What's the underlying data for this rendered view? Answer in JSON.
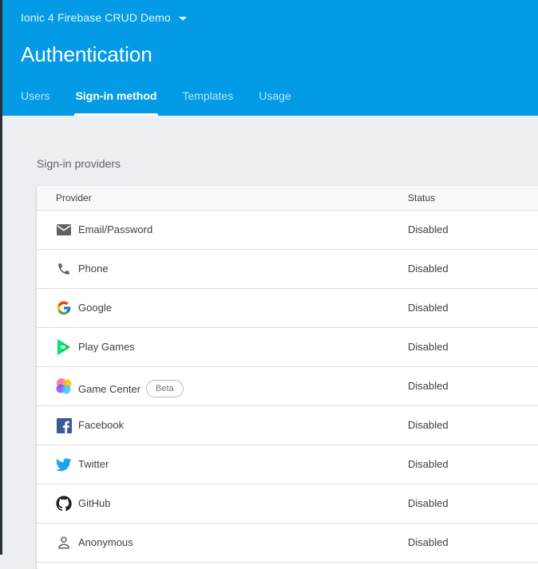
{
  "header": {
    "project_name": "Ionic 4 Firebase CRUD Demo",
    "title": "Authentication",
    "tabs": [
      {
        "label": "Users"
      },
      {
        "label": "Sign-in method"
      },
      {
        "label": "Templates"
      },
      {
        "label": "Usage"
      }
    ],
    "active_tab": "Sign-in method",
    "accent_color": "#039be5"
  },
  "section": {
    "title": "Sign-in providers"
  },
  "table": {
    "columns": {
      "provider": "Provider",
      "status": "Status"
    },
    "rows": [
      {
        "icon": "email-icon",
        "provider": "Email/Password",
        "status": "Disabled"
      },
      {
        "icon": "phone-icon",
        "provider": "Phone",
        "status": "Disabled"
      },
      {
        "icon": "google-icon",
        "provider": "Google",
        "status": "Disabled"
      },
      {
        "icon": "play-games-icon",
        "provider": "Play Games",
        "status": "Disabled"
      },
      {
        "icon": "game-center-icon",
        "provider": "Game Center",
        "badge": "Beta",
        "status": "Disabled"
      },
      {
        "icon": "facebook-icon",
        "provider": "Facebook",
        "status": "Disabled"
      },
      {
        "icon": "twitter-icon",
        "provider": "Twitter",
        "status": "Disabled"
      },
      {
        "icon": "github-icon",
        "provider": "GitHub",
        "status": "Disabled"
      },
      {
        "icon": "anonymous-icon",
        "provider": "Anonymous",
        "status": "Disabled"
      }
    ]
  }
}
